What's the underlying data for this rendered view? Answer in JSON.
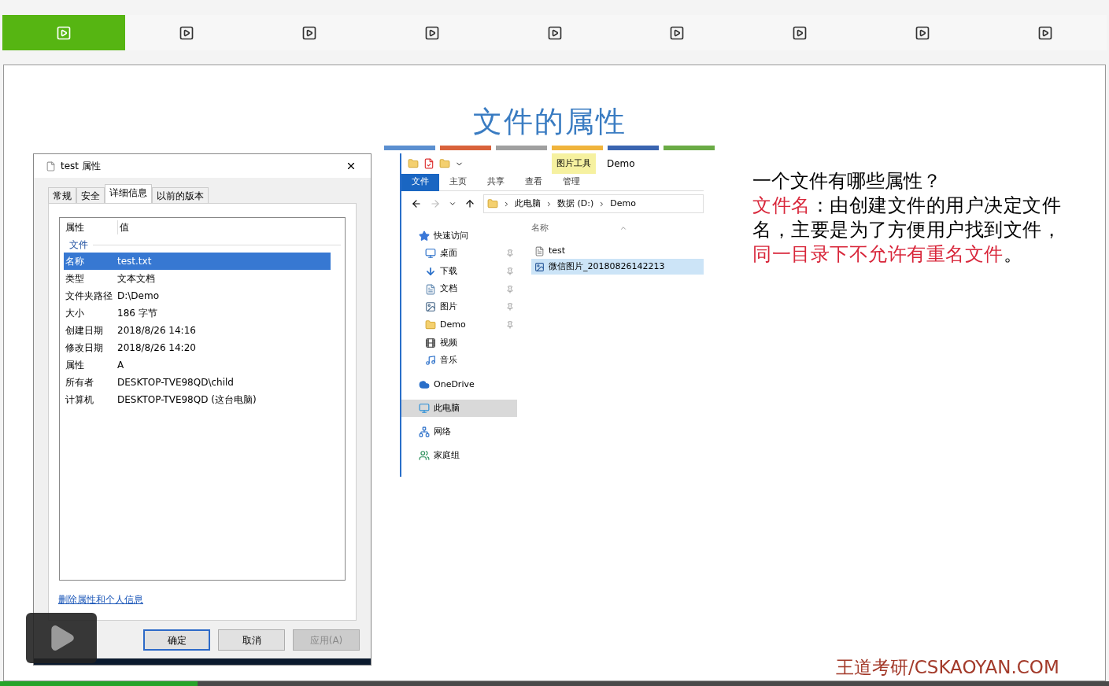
{
  "player_tabs": [
    {
      "selected": true
    },
    {
      "selected": false
    },
    {
      "selected": false
    },
    {
      "selected": false
    },
    {
      "selected": false
    },
    {
      "selected": false
    },
    {
      "selected": false
    },
    {
      "selected": false
    },
    {
      "selected": false
    }
  ],
  "slide": {
    "title": "文件的属性",
    "properties_dialog": {
      "title": "test 属性",
      "tabs": [
        {
          "label": "常规",
          "selected": false
        },
        {
          "label": "安全",
          "selected": false
        },
        {
          "label": "详细信息",
          "selected": true
        },
        {
          "label": "以前的版本",
          "selected": false
        }
      ],
      "columns": [
        "属性",
        "值"
      ],
      "group": "文件",
      "rows": [
        {
          "property": "名称",
          "value": "test.txt",
          "selected": true
        },
        {
          "property": "类型",
          "value": "文本文档",
          "selected": false
        },
        {
          "property": "文件夹路径",
          "value": "D:\\Demo",
          "selected": false
        },
        {
          "property": "大小",
          "value": "186 字节",
          "selected": false
        },
        {
          "property": "创建日期",
          "value": "2018/8/26 14:16",
          "selected": false
        },
        {
          "property": "修改日期",
          "value": "2018/8/26 14:20",
          "selected": false
        },
        {
          "property": "属性",
          "value": "A",
          "selected": false
        },
        {
          "property": "所有者",
          "value": "DESKTOP-TVE98QD\\child",
          "selected": false
        },
        {
          "property": "计算机",
          "value": "DESKTOP-TVE98QD (这台电脑)",
          "selected": false
        }
      ],
      "link": "删除属性和个人信息",
      "buttons": [
        {
          "label": "确定",
          "default": true,
          "disabled": false
        },
        {
          "label": "取消",
          "default": false,
          "disabled": false
        },
        {
          "label": "应用(A)",
          "default": false,
          "disabled": true
        }
      ]
    },
    "explorer": {
      "tool_tab": "图片工具",
      "window_title": "Demo",
      "ribbon_tabs": [
        {
          "label": "文件",
          "selected": true
        },
        {
          "label": "主页",
          "selected": false
        },
        {
          "label": "共享",
          "selected": false
        },
        {
          "label": "查看",
          "selected": false
        },
        {
          "label": "管理",
          "selected": false
        }
      ],
      "breadcrumb": [
        "此电脑",
        "数据 (D:)",
        "Demo"
      ],
      "nav_items": [
        {
          "label": "快速访问",
          "kind": "star",
          "selected": false,
          "children": [
            {
              "label": "桌面",
              "kind": "desktop",
              "pinned": true
            },
            {
              "label": "下载",
              "kind": "download",
              "pinned": true
            },
            {
              "label": "文档",
              "kind": "document",
              "pinned": true
            },
            {
              "label": "图片",
              "kind": "picture",
              "pinned": true
            },
            {
              "label": "Demo",
              "kind": "folder",
              "pinned": true
            },
            {
              "label": "视频",
              "kind": "video",
              "pinned": false
            },
            {
              "label": "音乐",
              "kind": "music",
              "pinned": false
            }
          ]
        },
        {
          "label": "OneDrive",
          "kind": "cloud",
          "selected": false
        },
        {
          "label": "此电脑",
          "kind": "computer",
          "selected": true
        },
        {
          "label": "网络",
          "kind": "network",
          "selected": false
        },
        {
          "label": "家庭组",
          "kind": "homegroup",
          "selected": false
        }
      ],
      "file_column": "名称",
      "files": [
        {
          "name": "test",
          "kind": "text",
          "selected": false
        },
        {
          "name": "微信图片_20180826142213",
          "kind": "image",
          "selected": true
        }
      ]
    },
    "notes": {
      "question": "一个文件有哪些属性？",
      "segments": [
        {
          "text": "文件名",
          "highlight": true
        },
        {
          "text": "：由创建文件的用户决定文件名，主要是为了方便用户找到文件，",
          "highlight": false
        },
        {
          "text": "同一目录下不允许有重名文件",
          "highlight": true
        },
        {
          "text": "。",
          "highlight": false
        }
      ]
    },
    "footer": "王道考研/CSKAOYAN.COM"
  },
  "progress": {
    "level": 0.178
  }
}
